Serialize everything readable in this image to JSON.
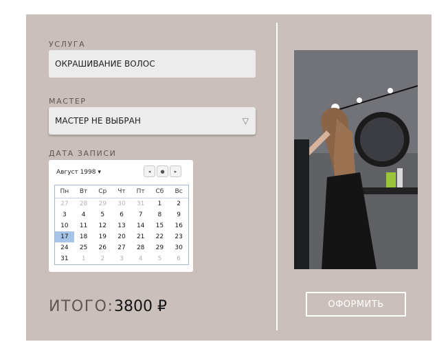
{
  "service": {
    "label": "УСЛУГА",
    "value": "ОКРАШИВАНИЕ ВОЛОС"
  },
  "master": {
    "label": "МАСТЕР",
    "value": "МАСТЕР НЕ ВЫБРАН",
    "arrow": "▽"
  },
  "date": {
    "label": "ДАТА ЗАПИСИ",
    "month": "Август 1998 ▾",
    "nav": {
      "prev": "◂",
      "today": "●",
      "next": "▸"
    },
    "weekdays": [
      "Пн",
      "Вт",
      "Ср",
      "Чт",
      "Пт",
      "Сб",
      "Вс"
    ],
    "weeks": [
      [
        "27",
        "28",
        "29",
        "30",
        "31",
        "1",
        "2"
      ],
      [
        "3",
        "4",
        "5",
        "6",
        "7",
        "8",
        "9"
      ],
      [
        "10",
        "11",
        "12",
        "13",
        "14",
        "15",
        "16"
      ],
      [
        "17",
        "18",
        "19",
        "20",
        "21",
        "22",
        "23"
      ],
      [
        "24",
        "25",
        "26",
        "27",
        "28",
        "29",
        "30"
      ],
      [
        "31",
        "1",
        "2",
        "3",
        "4",
        "5",
        "6"
      ]
    ],
    "selected": "17"
  },
  "total": {
    "label": "ИТОГО:",
    "value": "3800 ₽"
  },
  "order_button": "ОФОРМИТЬ",
  "colors": {
    "panel": "#cbbfbb",
    "selected_day": "#a6c4e8"
  }
}
